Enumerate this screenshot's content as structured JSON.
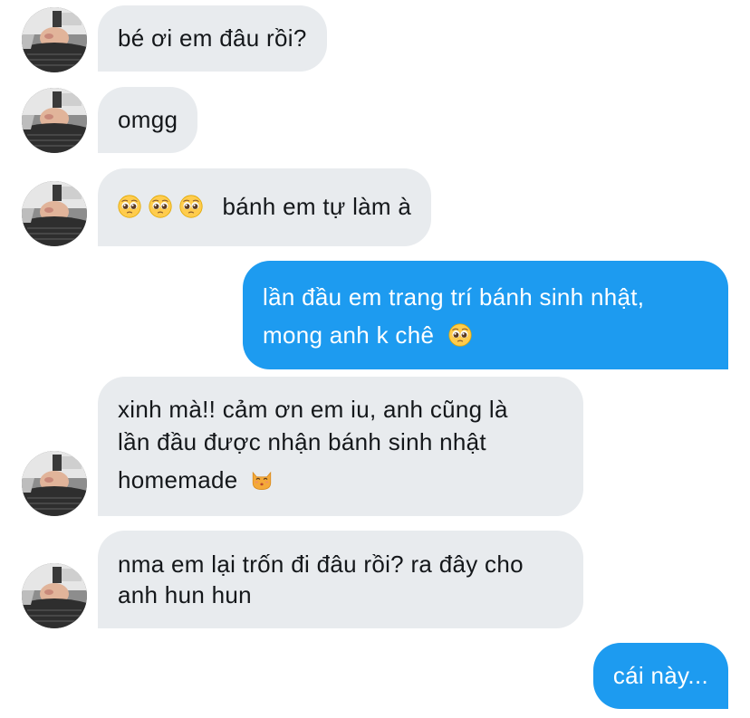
{
  "conversation": {
    "messages": [
      {
        "sender": "other",
        "text": "bé ơi em đâu rồi?"
      },
      {
        "sender": "other",
        "text": "omgg"
      },
      {
        "sender": "other",
        "emoji": [
          "pleading-face",
          "pleading-face",
          "pleading-face"
        ],
        "text": "bánh em tự làm à"
      },
      {
        "sender": "me",
        "lines": [
          "lần đầu em trang trí bánh sinh nhật,",
          "mong anh k chê"
        ],
        "emoji": "pleading-face"
      },
      {
        "sender": "other",
        "lines": [
          "xinh mà!! cảm ơn em iu, anh cũng là",
          "lần đầu được nhận bánh sinh nhật",
          "homemade"
        ],
        "emoji": "kissing-cat-face"
      },
      {
        "sender": "other",
        "lines": [
          "nma em lại trốn đi đâu rồi? ra đây cho",
          "anh hun hun"
        ]
      },
      {
        "sender": "me",
        "text": "cái này..."
      }
    ]
  },
  "colors": {
    "incoming_bubble": "#e8ebee",
    "outgoing_bubble": "#1d9bf0",
    "incoming_text": "#14171a",
    "outgoing_text": "#ffffff"
  }
}
